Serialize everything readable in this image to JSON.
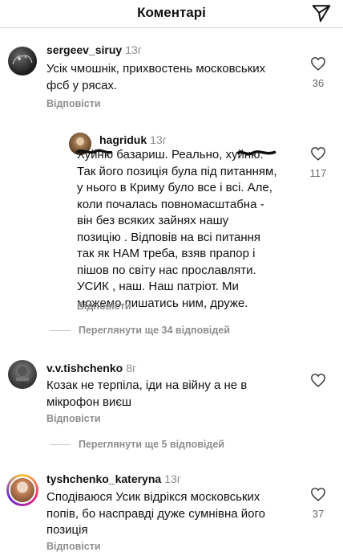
{
  "header": {
    "title": "Коментарі"
  },
  "comments": [
    {
      "username": "sergeev_siruy",
      "time": "13г",
      "lines": [
        "Усік чмошнік, прихвостень московських",
        "фсб у рясах."
      ],
      "likes": "36",
      "reply_label": "Відповісти"
    },
    {
      "username": "hagriduk",
      "time": "13г",
      "lines": [
        "Хуйню базариш. Реально, хуйню.",
        "Так його позиція була під питанням,",
        "у нього в Криму було все і всі. Але,",
        "коли почалась  повномасштабна -",
        "він без всяких зайнях нашу",
        "позицію . Відповів на всі питання",
        "так як НАМ треба, взяв прапор і",
        "пішов по світу нас прославляти.",
        "УСИК , наш. Наш патріот. Ми",
        "можемо пишатись ним, друже."
      ],
      "likes": "117",
      "reply_label": "Відповісти"
    },
    {
      "username": "v.v.tishchenko",
      "time": "8г",
      "lines": [
        "Козак не терпіла, іди на війну а не в",
        "мікрофон виєш"
      ],
      "likes": "",
      "reply_label": "Відповісти"
    },
    {
      "username": "tyshchenko_kateryna",
      "time": "13г",
      "lines": [
        "Сподіваюся Усик відрікся московських",
        "попів, бо насправді дуже сумнівна його",
        "позиція"
      ],
      "likes": "37",
      "reply_label": "Відповісти"
    }
  ],
  "view_more": [
    "Переглянути ще 34 відповідей",
    "Переглянути ще 5 відповідей"
  ]
}
